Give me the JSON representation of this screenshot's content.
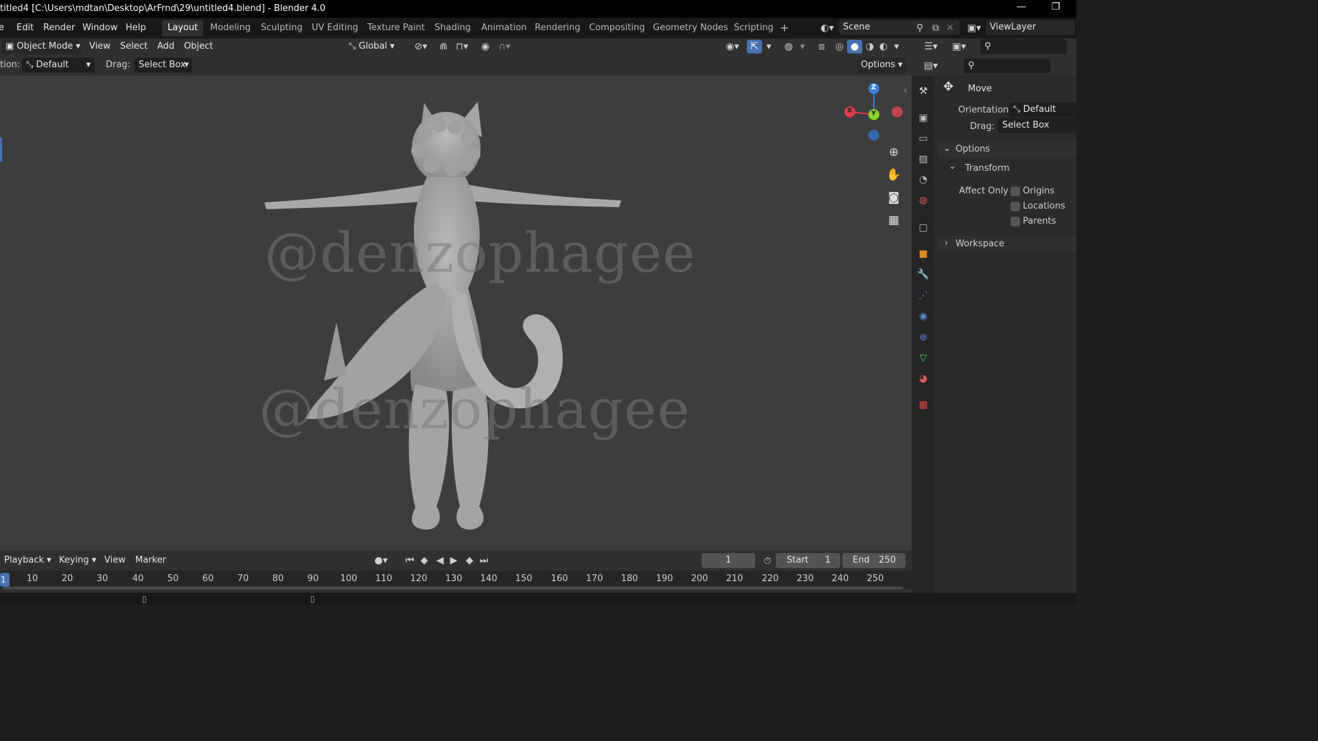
{
  "titlebar": {
    "title": "titled4 [C:\\Users\\mdtan\\Desktop\\ArFrnd\\29\\untitled4.blend] - Blender 4.0",
    "minimize": "—",
    "restore": "❐"
  },
  "menu": {
    "items": [
      "Edit",
      "Render",
      "Window",
      "Help"
    ],
    "tabs": [
      "Layout",
      "Modeling",
      "Sculpting",
      "UV Editing",
      "Texture Paint",
      "Shading",
      "Animation",
      "Rendering",
      "Compositing",
      "Geometry Nodes",
      "Scripting"
    ],
    "add_tab": "+",
    "scene": "Scene",
    "view_layer": "ViewLayer"
  },
  "viewport_header": {
    "mode": "Object Mode",
    "menus": [
      "View",
      "Select",
      "Add",
      "Object"
    ],
    "transform_orientation": "Global"
  },
  "tool_settings": {
    "orientation_label": "tion:",
    "orientation_value": "Default",
    "drag_label": "Drag:",
    "drag_value": "Select Box",
    "options": "Options"
  },
  "viewport": {
    "watermark": "@denzophagee",
    "gizmo": {
      "x": "X",
      "y": "Y",
      "z": "Z"
    }
  },
  "properties": {
    "tool_name": "Move",
    "orientation_label": "Orientation",
    "orientation_value": "Default",
    "drag_label": "Drag:",
    "drag_value": "Select Box",
    "options_section": "Options",
    "transform_section": "Transform",
    "affect_only_label": "Affect Only",
    "checkboxes": [
      "Origins",
      "Locations",
      "Parents"
    ],
    "workspace_section": "Workspace"
  },
  "timeline": {
    "menus": [
      "Playback",
      "Keying",
      "View",
      "Marker"
    ],
    "current_frame": "1",
    "start_label": "Start",
    "start_value": "1",
    "end_label": "End",
    "end_value": "250",
    "ticks": [
      "10",
      "20",
      "30",
      "40",
      "50",
      "60",
      "70",
      "80",
      "90",
      "100",
      "110",
      "120",
      "130",
      "140",
      "150",
      "160",
      "170",
      "180",
      "190",
      "200",
      "210",
      "220",
      "230",
      "240",
      "250"
    ],
    "playhead": "1"
  },
  "colors": {
    "accent_blue": "#4772b3",
    "axis_x": "#e2394b",
    "axis_y": "#8bd425",
    "axis_z": "#3c7fd6",
    "viewport_bg": "#3d3d3d"
  }
}
